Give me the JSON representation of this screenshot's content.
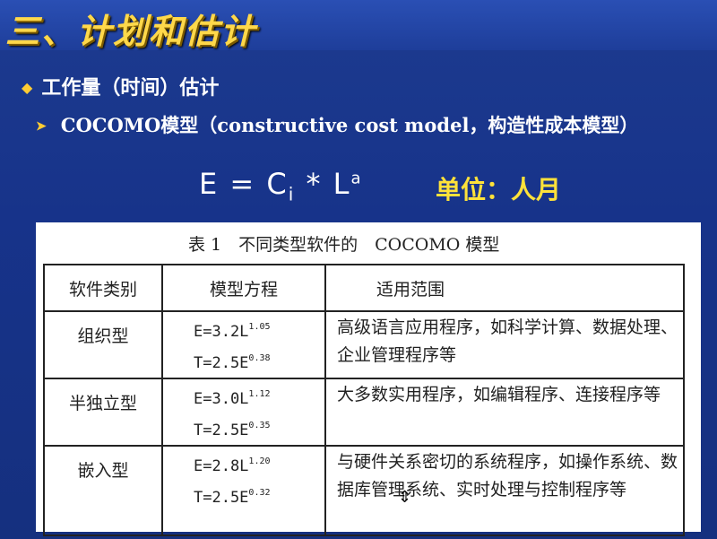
{
  "slide": {
    "title": "三、计划和估计",
    "bullet1": "工作量（时间）估计",
    "bullet2": "COCOMO模型（constructive cost model，构造性成本模型）",
    "formula": {
      "e": "E = C",
      "sub": "i",
      "mid": " * L",
      "sup": "a"
    },
    "unit": "单位：人月"
  },
  "table": {
    "caption": "表 1　不同类型软件的　COCOMO 模型",
    "headers": [
      "软件类别",
      "模型方程",
      "适用范围"
    ],
    "rows": [
      {
        "category": "组织型",
        "e_base": "E=3.2L",
        "e_exp": "1.05",
        "t_base": "T=2.5E",
        "t_exp": "0.38",
        "scope": "高级语言应用程序，如科学计算、数据处理、企业管理程序等"
      },
      {
        "category": "半独立型",
        "e_base": "E=3.0L",
        "e_exp": "1.12",
        "t_base": "T=2.5E",
        "t_exp": "0.35",
        "scope": "大多数实用程序，如编辑程序、连接程序等"
      },
      {
        "category": "嵌入型",
        "e_base": "E=2.8L",
        "e_exp": "1.20",
        "t_base": "T=2.5E",
        "t_exp": "0.32",
        "scope": "与硬件关系密切的系统程序，如操作系统、数据库管理系统、实时处理与控制程序等"
      }
    ]
  },
  "colors": {
    "title": "#ffd84a",
    "unit": "#ffe23a",
    "background": "#17338a"
  }
}
